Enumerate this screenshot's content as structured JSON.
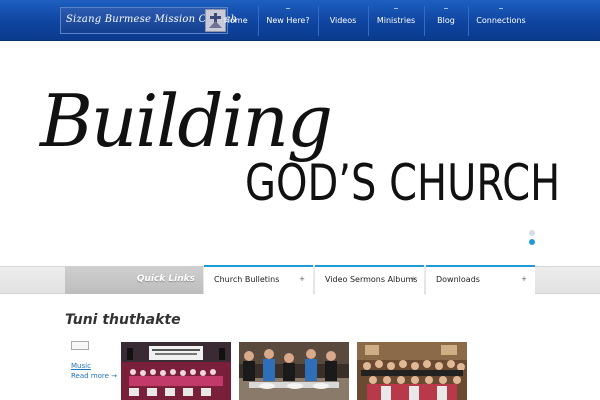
{
  "header": {
    "logo_text": "Sizang Burmese Mission Church",
    "nav": [
      {
        "label": "Home",
        "active": true
      },
      {
        "label": "New Here?",
        "active": false
      },
      {
        "label": "Videos",
        "active": false
      },
      {
        "label": "Ministries",
        "active": false
      },
      {
        "label": "Blog",
        "active": false
      },
      {
        "label": "Connections",
        "active": false
      }
    ]
  },
  "hero": {
    "script_text": "Building",
    "caps_text": "GOD’S CHURCH",
    "slider_dots": [
      {
        "state": "inactive",
        "color": "#d7dde6"
      },
      {
        "state": "active",
        "color": "#1e9bd7"
      }
    ]
  },
  "quick_links": {
    "label": "Quick Links",
    "tabs": [
      {
        "label": "Church Bulletins",
        "arrow": "+"
      },
      {
        "label": "Video Sermons Albums",
        "arrow": "+"
      },
      {
        "label": "Downloads",
        "arrow": "+"
      }
    ]
  },
  "section": {
    "title": "Tuni thuthakte",
    "category_label": "Music",
    "read_more": "Read more →",
    "thumbnails": [
      {
        "icon": "choir-stage-photo"
      },
      {
        "icon": "food-line-photo"
      },
      {
        "icon": "group-photo"
      }
    ]
  },
  "colors": {
    "nav_bg": "#0f45a0",
    "accent": "#1e9bd7",
    "link": "#1e73be"
  }
}
